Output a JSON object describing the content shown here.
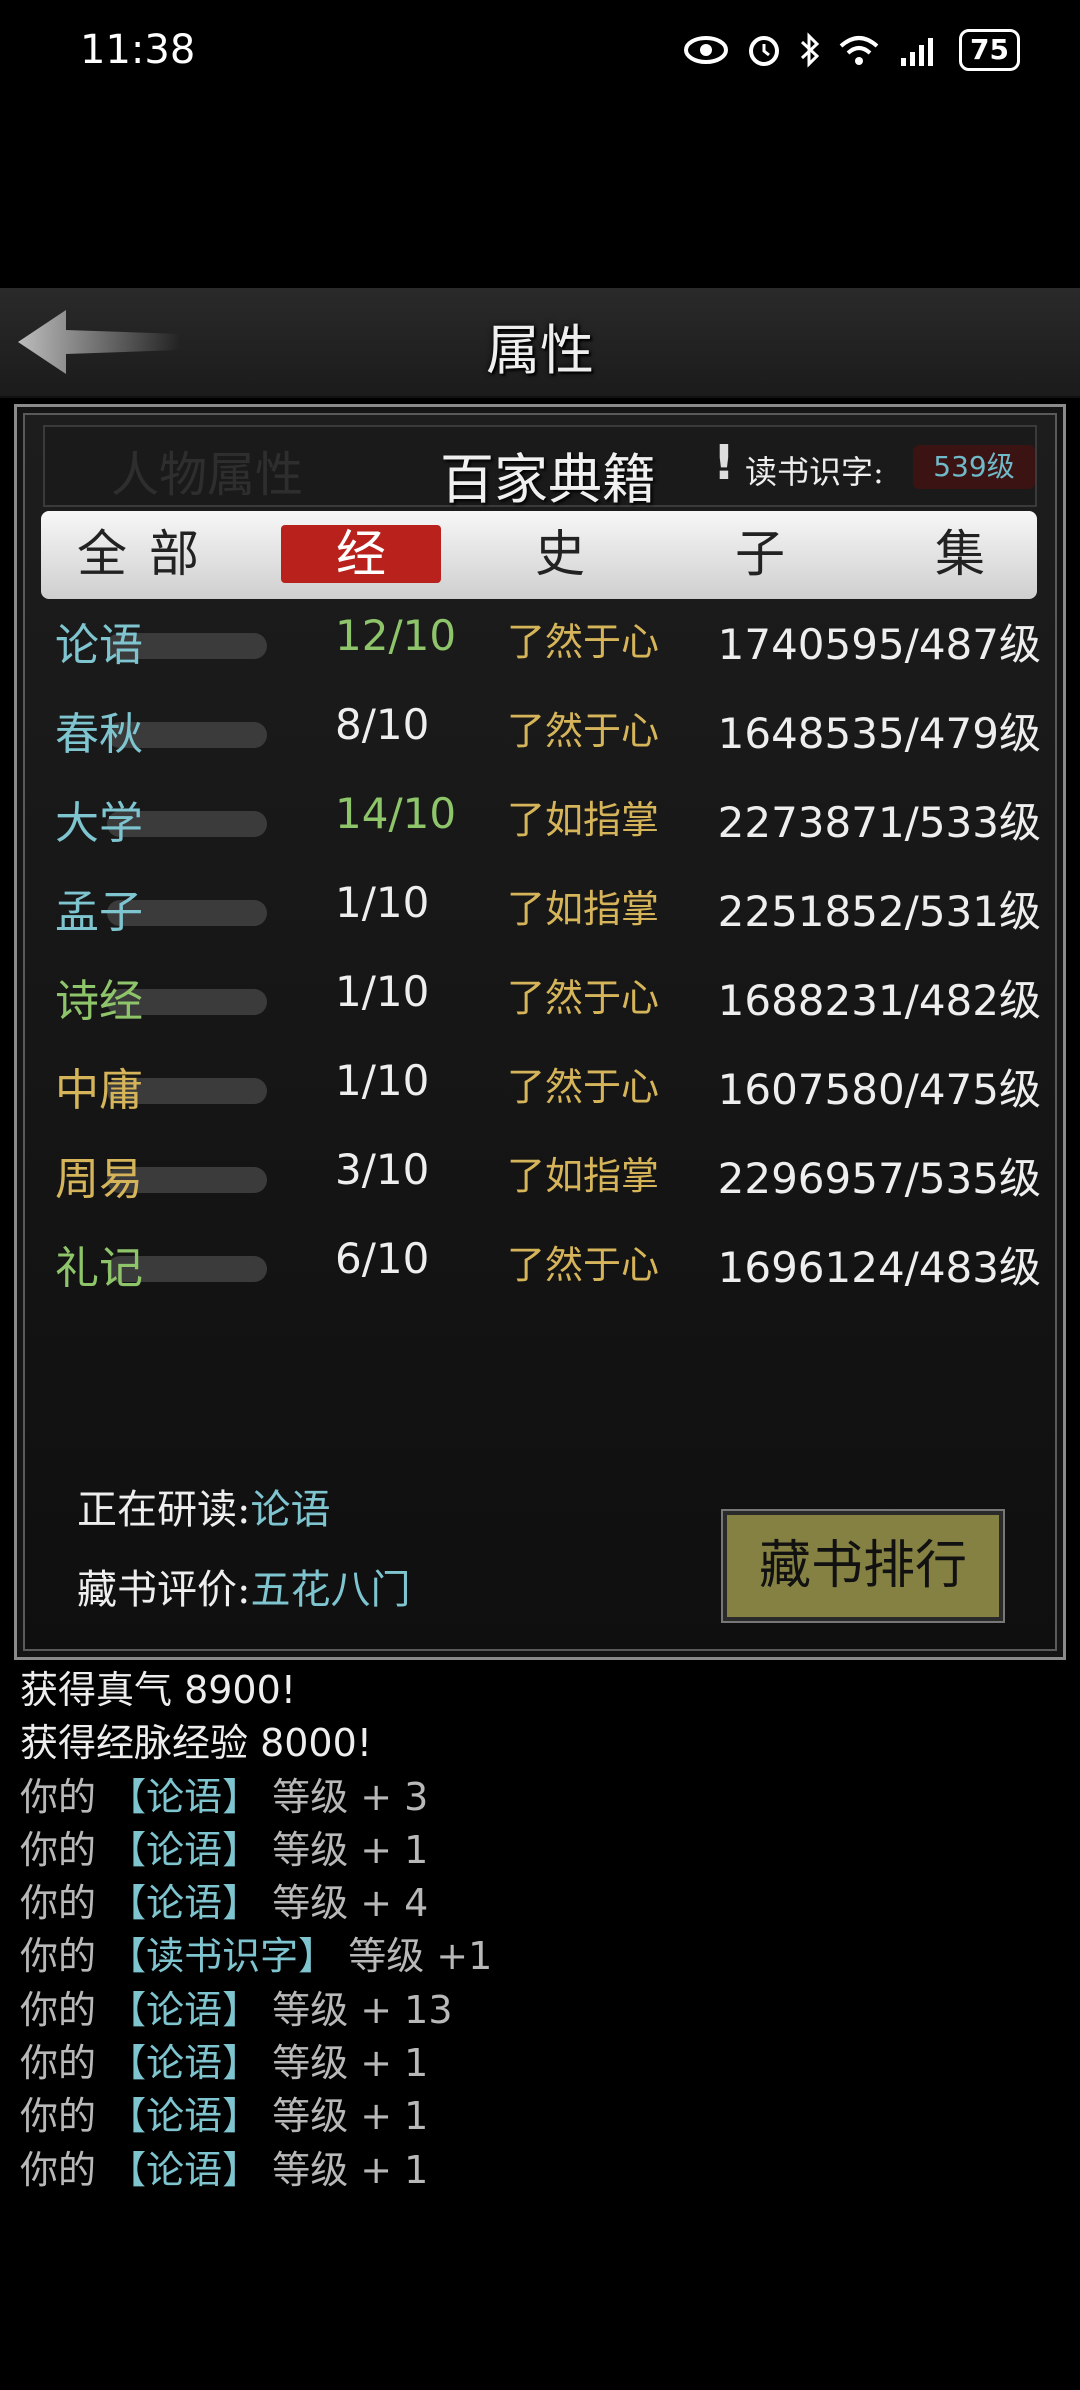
{
  "status_bar": {
    "time": "11:38",
    "icons": [
      "eye-icon",
      "alarm-icon",
      "bluetooth-icon",
      "wifi-icon",
      "4g-signal-icon"
    ],
    "battery": "75"
  },
  "header": {
    "title": "属性",
    "back_icon": "back-arrow-icon"
  },
  "panel": {
    "ghost_tab": "人物属性",
    "title": "百家典籍",
    "info_mark": "!",
    "reading_label": "读书识字:",
    "reading_level": "539级",
    "tabs": [
      {
        "label": "全部",
        "active": false
      },
      {
        "label": "经",
        "active": true
      },
      {
        "label": "史",
        "active": false
      },
      {
        "label": "子",
        "active": false
      },
      {
        "label": "集",
        "active": false
      }
    ],
    "books": [
      {
        "name": "论语",
        "name_color": "#7ec5d0",
        "progress": "12/10",
        "progress_color": "#8fc56a",
        "status": "了然于心",
        "exp": "1740595/487级"
      },
      {
        "name": "春秋",
        "name_color": "#7ec5d0",
        "progress": "8/10",
        "progress_color": "#eeeeee",
        "status": "了然于心",
        "exp": "1648535/479级"
      },
      {
        "name": "大学",
        "name_color": "#7ec5d0",
        "progress": "14/10",
        "progress_color": "#8fc56a",
        "status": "了如指掌",
        "exp": "2273871/533级"
      },
      {
        "name": "孟子",
        "name_color": "#7ec5d0",
        "progress": "1/10",
        "progress_color": "#eeeeee",
        "status": "了如指掌",
        "exp": "2251852/531级"
      },
      {
        "name": "诗经",
        "name_color": "#8fc56a",
        "progress": "1/10",
        "progress_color": "#eeeeee",
        "status": "了然于心",
        "exp": "1688231/482级"
      },
      {
        "name": "中庸",
        "name_color": "#d6b55a",
        "progress": "1/10",
        "progress_color": "#eeeeee",
        "status": "了然于心",
        "exp": "1607580/475级"
      },
      {
        "name": "周易",
        "name_color": "#d6b55a",
        "progress": "3/10",
        "progress_color": "#eeeeee",
        "status": "了如指掌",
        "exp": "2296957/535级"
      },
      {
        "name": "礼记",
        "name_color": "#8fc56a",
        "progress": "6/10",
        "progress_color": "#eeeeee",
        "status": "了然于心",
        "exp": "1696124/483级"
      }
    ],
    "studying_label": "正在研读:",
    "studying_value": "论语",
    "rating_label": "藏书评价:",
    "rating_value": "五花八门",
    "rank_button": "藏书排行"
  },
  "log": [
    {
      "prefix": "获得真气 8900!",
      "book": "",
      "suffix": ""
    },
    {
      "prefix": "获得经脉经验 8000!",
      "book": "",
      "suffix": ""
    },
    {
      "prefix": "你的 ",
      "book": "【论语】",
      "suffix": " 等级 + 3"
    },
    {
      "prefix": "你的 ",
      "book": "【论语】",
      "suffix": " 等级 + 1"
    },
    {
      "prefix": "你的 ",
      "book": "【论语】",
      "suffix": " 等级 + 4"
    },
    {
      "prefix": "你的 ",
      "book": "【读书识字】",
      "suffix": " 等级 +1"
    },
    {
      "prefix": "你的 ",
      "book": "【论语】",
      "suffix": " 等级 + 13"
    },
    {
      "prefix": "你的 ",
      "book": "【论语】",
      "suffix": " 等级 + 1"
    },
    {
      "prefix": "你的 ",
      "book": "【论语】",
      "suffix": " 等级 + 1"
    },
    {
      "prefix": "你的 ",
      "book": "【论语】",
      "suffix": " 等级 + 1"
    }
  ]
}
